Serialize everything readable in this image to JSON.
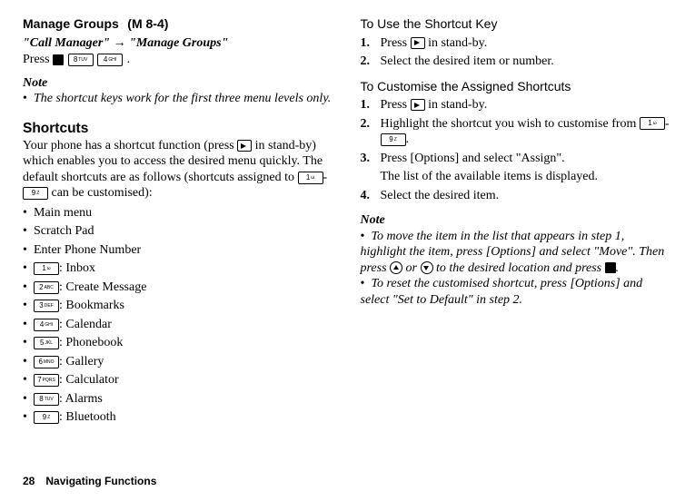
{
  "left": {
    "heading": "Manage Groups",
    "mref": "(M 8-4)",
    "breadcrumb_a": "\"Call Manager\"",
    "breadcrumb_arrow": " → ",
    "breadcrumb_b": "\"Manage Groups\"",
    "press_word": "Press ",
    "press_end": ".",
    "note_label": "Note",
    "note_text": "The shortcut keys work for the first three menu levels only.",
    "shortcuts_heading": "Shortcuts",
    "shortcuts_intro_a": "Your phone has a shortcut function (press ",
    "shortcuts_intro_b": " in stand-by) which enables you to access the desired menu quickly. The default shortcuts are as follows (shortcuts assigned to ",
    "shortcuts_intro_dash": "-",
    "shortcuts_intro_c": " can be customised):",
    "items": [
      {
        "text": "Main menu"
      },
      {
        "text": "Scratch Pad"
      },
      {
        "text": "Enter Phone Number"
      },
      {
        "key": "1",
        "text": ": Inbox"
      },
      {
        "key": "2",
        "text": ": Create Message"
      },
      {
        "key": "3",
        "text": ": Bookmarks"
      },
      {
        "key": "4",
        "text": ": Calendar"
      },
      {
        "key": "5",
        "text": ": Phonebook"
      },
      {
        "key": "6",
        "text": ": Gallery"
      },
      {
        "key": "7",
        "text": ": Calculator"
      },
      {
        "key": "8",
        "text": ": Alarms"
      },
      {
        "key": "9",
        "text": ": Bluetooth"
      }
    ],
    "press_keys": [
      "8",
      "4"
    ],
    "range_low": "1",
    "range_high": "9"
  },
  "right": {
    "use_heading": "To Use the Shortcut Key",
    "use_steps": [
      {
        "num": "1.",
        "a": "Press ",
        "b": " in stand-by."
      },
      {
        "num": "2.",
        "text": "Select the desired item or number."
      }
    ],
    "cust_heading": "To Customise the Assigned Shortcuts",
    "cust_steps": [
      {
        "num": "1.",
        "a": "Press ",
        "b": " in stand-by."
      },
      {
        "num": "2.",
        "a": "Highlight the shortcut you wish to customise from ",
        "dash": "-",
        "b": "."
      },
      {
        "num": "3.",
        "text": "Press [Options] and select \"Assign\".",
        "sub": "The list of the available items is displayed."
      },
      {
        "num": "4.",
        "text": "Select the desired item."
      }
    ],
    "range_low": "1",
    "range_high": "9",
    "note_label": "Note",
    "note1_a": "To move the item in the list that appears in step 1, highlight the item, press [Options] and select \"Move\". Then press ",
    "note1_or": " or ",
    "note1_b": " to the desired location and press ",
    "note1_c": ".",
    "note2": "To reset the customised shortcut, press [Options] and select \"Set to Default\" in step 2."
  },
  "footer": {
    "page": "28",
    "title": "Navigating Functions"
  }
}
